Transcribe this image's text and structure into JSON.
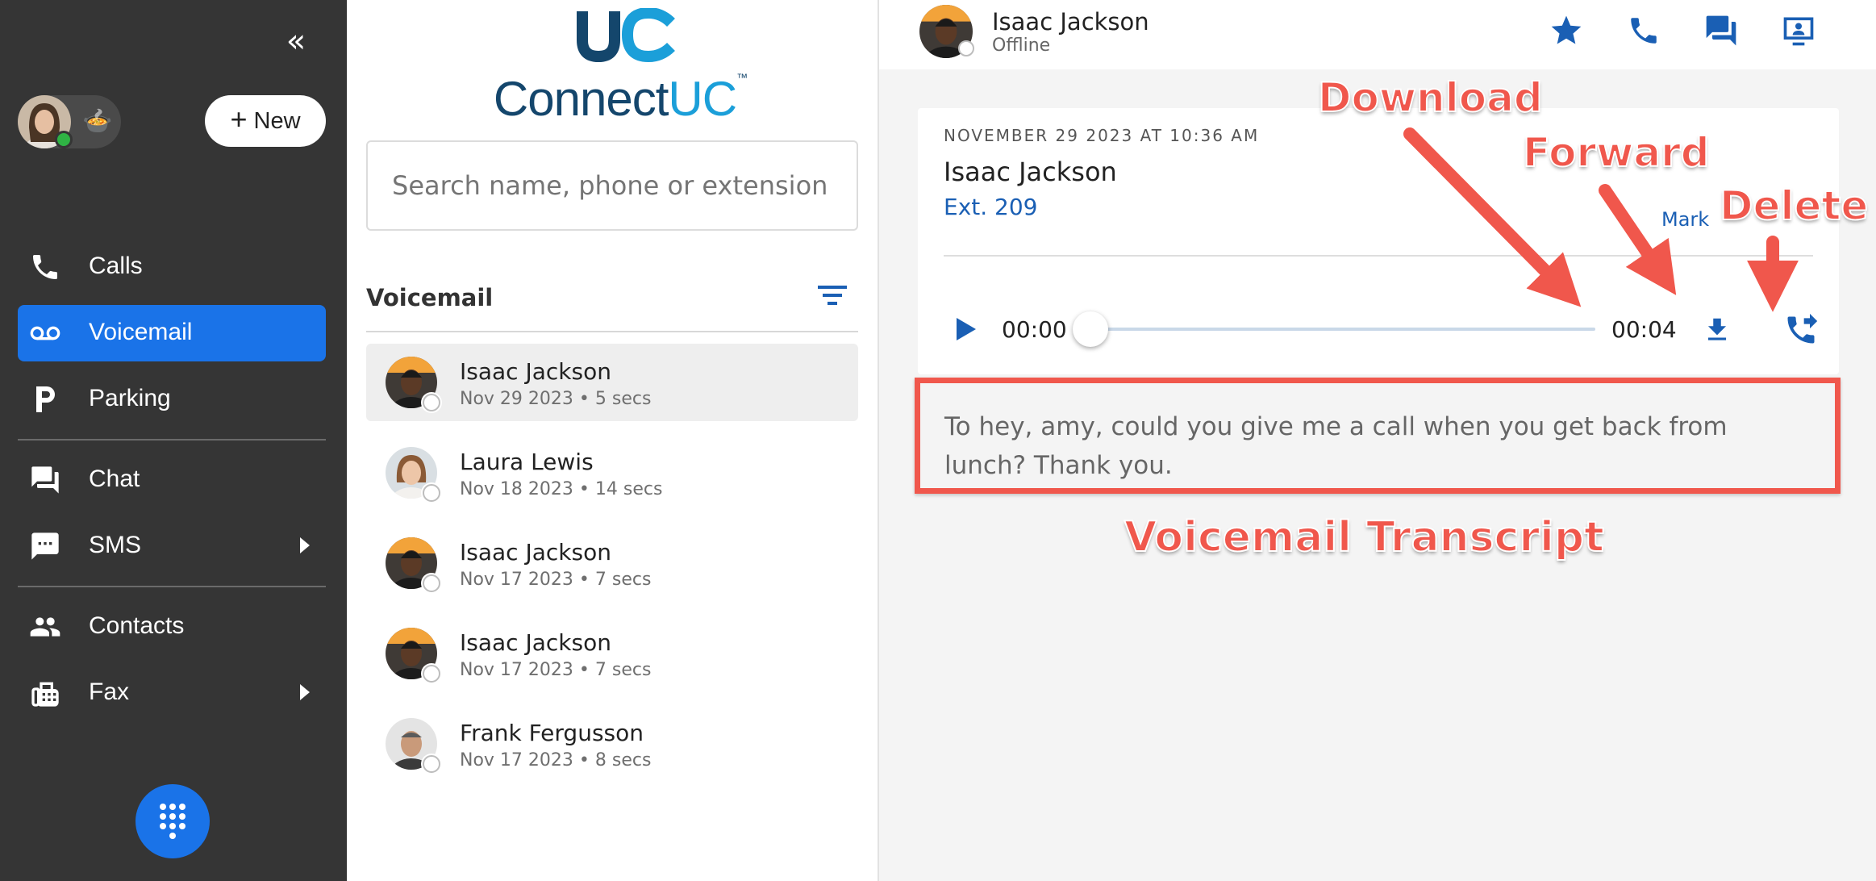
{
  "nav": {
    "collapse_symbol": "«",
    "new_button": {
      "plus": "+",
      "label": "New"
    },
    "user_status_emoji": "🍲",
    "items": [
      {
        "label": "Calls",
        "icon": "phone-icon",
        "active": false,
        "has_submenu": false
      },
      {
        "label": "Voicemail",
        "icon": "voicemail-icon",
        "active": true,
        "has_submenu": false
      },
      {
        "label": "Parking",
        "icon": "parking-icon",
        "active": false,
        "has_submenu": false
      },
      {
        "label": "Chat",
        "icon": "chat-icon",
        "active": false,
        "has_submenu": false
      },
      {
        "label": "SMS",
        "icon": "sms-icon",
        "active": false,
        "has_submenu": true
      },
      {
        "label": "Contacts",
        "icon": "contacts-icon",
        "active": false,
        "has_submenu": false
      },
      {
        "label": "Fax",
        "icon": "fax-icon",
        "active": false,
        "has_submenu": true
      }
    ],
    "colors": {
      "background": "#353535",
      "active": "#1a73e8",
      "status_online": "#2fb344"
    }
  },
  "brand": {
    "name_left": "Connect",
    "name_right": "UC",
    "trademark": "™"
  },
  "search": {
    "placeholder": "Search name, phone or extension",
    "value": ""
  },
  "voicemail_list": {
    "title": "Voicemail",
    "items": [
      {
        "name": "Isaac Jackson",
        "meta": "Nov 29 2023 • 5 secs",
        "selected": true
      },
      {
        "name": "Laura Lewis",
        "meta": "Nov 18 2023 • 14 secs",
        "selected": false
      },
      {
        "name": "Isaac Jackson",
        "meta": "Nov 17 2023 • 7 secs",
        "selected": false
      },
      {
        "name": "Isaac Jackson",
        "meta": "Nov 17 2023 • 7 secs",
        "selected": false
      },
      {
        "name": "Frank Fergusson",
        "meta": "Nov 17 2023 • 8 secs",
        "selected": false
      }
    ]
  },
  "header": {
    "contact_name": "Isaac Jackson",
    "presence": "Offline",
    "actions": [
      "star-icon",
      "phone-icon",
      "chat-icon",
      "screen-share-icon"
    ]
  },
  "voicemail_detail": {
    "datetime": "NOVEMBER 29 2023 AT 10:36 AM",
    "caller": "Isaac Jackson",
    "extension": "Ext. 209",
    "mark_label": "Mark",
    "player": {
      "current_time": "00:00",
      "total_time": "00:04",
      "progress": 0
    },
    "actions": [
      "download-icon",
      "forward-icon",
      "delete-icon"
    ],
    "transcript": "To hey, amy, could you give me a call when you get back from lunch? Thank you."
  },
  "annotations": {
    "download": "Download",
    "forward": "Forward",
    "delete": "Delete",
    "transcript": "Voicemail Transcript",
    "color": "#f0574c"
  }
}
